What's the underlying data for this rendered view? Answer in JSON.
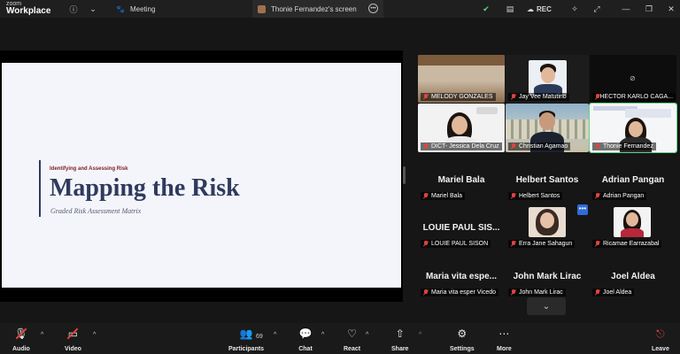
{
  "titlebar": {
    "brand_top": "zoom",
    "brand_bottom": "Workplace",
    "meeting_tab": "Meeting",
    "screen_tab": "Thonie Fernandez's screen",
    "rec_label": "REC"
  },
  "slide": {
    "kicker": "Identifying and Assessing Risk",
    "title": "Mapping the Risk",
    "subtitle": "Graded Risk Assessment Matrix"
  },
  "gallery": {
    "video_tiles": [
      {
        "name": "MELODY GONZALES"
      },
      {
        "name": "Jay Vee Matutino"
      },
      {
        "name": "HECTOR KARLO CAGA..."
      },
      {
        "name": "DICT- Jessica Dela Cruz"
      },
      {
        "name": "Christian Agamao"
      },
      {
        "name": "Thonie Fernandez"
      }
    ],
    "name_tiles": [
      {
        "big": "Mariel Bala",
        "small": "Mariel Bala"
      },
      {
        "big": "Helbert Santos",
        "small": "Helbert Santos"
      },
      {
        "big": "Adrian Pangan",
        "small": "Adrian Pangan"
      },
      {
        "big": "LOUIE PAUL SIS...",
        "small": "LOUIE PAUL SISON"
      },
      {
        "big": "",
        "small": "Erra Jane Sahagun"
      },
      {
        "big": "",
        "small": "Ricamae Earrazabal"
      },
      {
        "big": "Maria vita espe...",
        "small": "Maria vita esper Vicedo"
      },
      {
        "big": "John Mark Lirac",
        "small": "John Mark Lirac"
      },
      {
        "big": "Joel Aldea",
        "small": "Joel Aldea"
      }
    ]
  },
  "toolbar": {
    "audio": "Audio",
    "video": "Video",
    "participants": "Participants",
    "participants_count": "69",
    "chat": "Chat",
    "react": "React",
    "share": "Share",
    "settings": "Settings",
    "more": "More",
    "leave": "Leave"
  },
  "colors": {
    "accent_green": "#5fd47d",
    "mute_red": "#e0453b",
    "slide_title": "#2f3a5e",
    "kicker_red": "#7a1e24"
  }
}
